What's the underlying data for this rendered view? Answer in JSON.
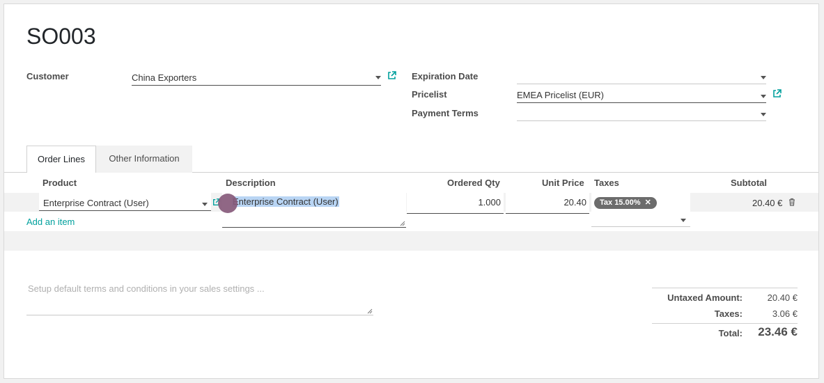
{
  "record": {
    "name": "SO003"
  },
  "form": {
    "customer_label": "Customer",
    "customer_value": "China Exporters",
    "expiration_label": "Expiration Date",
    "expiration_value": "",
    "pricelist_label": "Pricelist",
    "pricelist_value": "EMEA Pricelist (EUR)",
    "payment_terms_label": "Payment Terms",
    "payment_terms_value": ""
  },
  "tabs": [
    {
      "label": "Order Lines",
      "active": true
    },
    {
      "label": "Other Information",
      "active": false
    }
  ],
  "order_lines": {
    "columns": {
      "product": "Product",
      "description": "Description",
      "ordered_qty": "Ordered Qty",
      "unit_price": "Unit Price",
      "taxes": "Taxes",
      "subtotal": "Subtotal"
    },
    "rows": [
      {
        "product": "Enterprise Contract (User)",
        "description": "Enterprise Contract (User)",
        "ordered_qty": "1.000",
        "unit_price": "20.40",
        "tax": "Tax 15.00%",
        "subtotal": "20.40 €"
      }
    ],
    "add_item_label": "Add an item"
  },
  "terms_placeholder": "Setup default terms and conditions in your sales settings ...",
  "totals": {
    "untaxed_label": "Untaxed Amount:",
    "untaxed_value": "20.40 €",
    "taxes_label": "Taxes:",
    "taxes_value": "3.06 €",
    "total_label": "Total:",
    "total_value": "23.46 €"
  },
  "colors": {
    "accent": "#00a09d",
    "cursor": "#875a7b",
    "badge": "#6c6c6c",
    "selection": "#b9d5f4"
  },
  "icons": {
    "external_link": "external-link-icon",
    "dropdown": "chevron-down-icon",
    "delete": "trash-icon",
    "remove_tag": "close-icon"
  }
}
